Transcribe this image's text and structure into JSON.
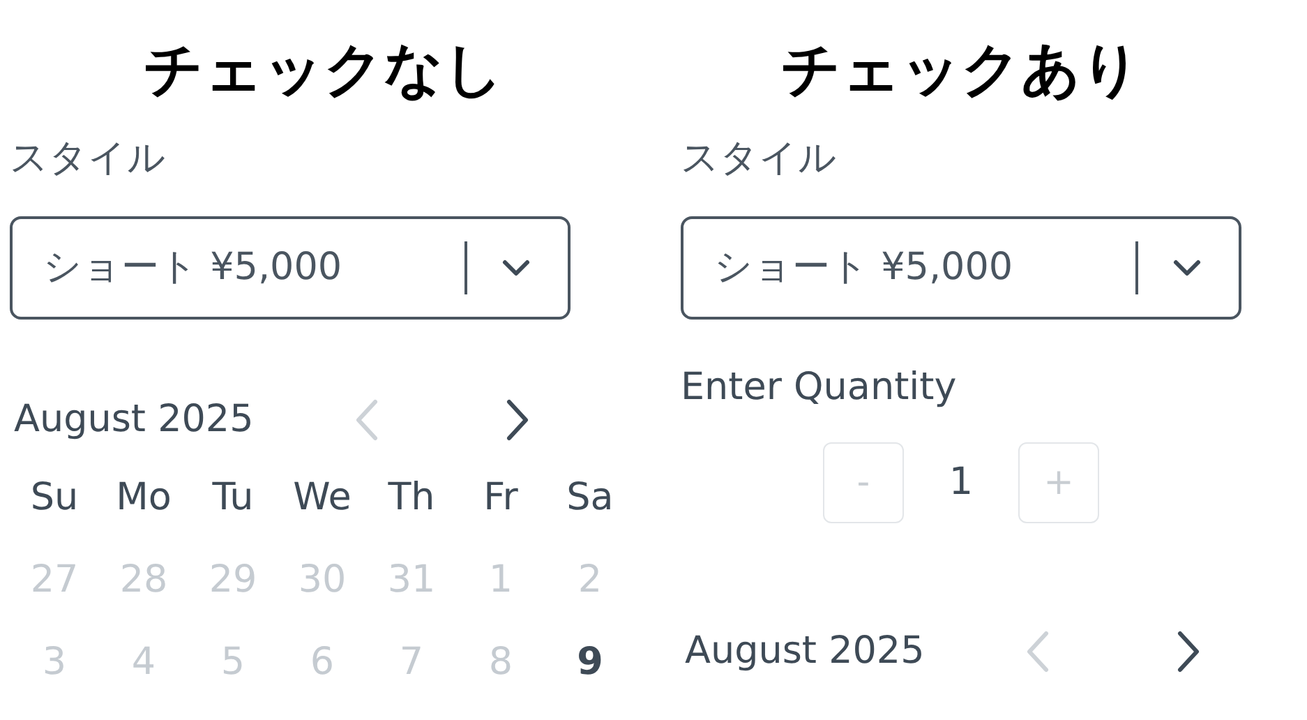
{
  "panels": [
    {
      "heading": "チェックなし",
      "style_field": {
        "label": "スタイル",
        "value": "ショート ¥5,000"
      },
      "calendar": {
        "month": "August 2025",
        "prev_disabled": true,
        "next_disabled": false,
        "weekdays": [
          "Su",
          "Mo",
          "Tu",
          "We",
          "Th",
          "Fr",
          "Sa"
        ],
        "weeks": [
          [
            {
              "day": "27",
              "disabled": true,
              "today": false
            },
            {
              "day": "28",
              "disabled": true,
              "today": false
            },
            {
              "day": "29",
              "disabled": true,
              "today": false
            },
            {
              "day": "30",
              "disabled": true,
              "today": false
            },
            {
              "day": "31",
              "disabled": true,
              "today": false
            },
            {
              "day": "1",
              "disabled": true,
              "today": false
            },
            {
              "day": "2",
              "disabled": true,
              "today": false
            }
          ],
          [
            {
              "day": "3",
              "disabled": true,
              "today": false
            },
            {
              "day": "4",
              "disabled": true,
              "today": false
            },
            {
              "day": "5",
              "disabled": true,
              "today": false
            },
            {
              "day": "6",
              "disabled": true,
              "today": false
            },
            {
              "day": "7",
              "disabled": true,
              "today": false
            },
            {
              "day": "8",
              "disabled": true,
              "today": false
            },
            {
              "day": "9",
              "disabled": false,
              "today": true
            }
          ]
        ]
      }
    },
    {
      "heading": "チェックあり",
      "style_field": {
        "label": "スタイル",
        "value": "ショート ¥5,000"
      },
      "quantity": {
        "label": "Enter Quantity",
        "minus": "-",
        "value": "1",
        "plus": "+",
        "minus_disabled": true,
        "plus_disabled": true
      },
      "calendar": {
        "month": "August 2025",
        "prev_disabled": true,
        "next_disabled": false
      }
    }
  ]
}
